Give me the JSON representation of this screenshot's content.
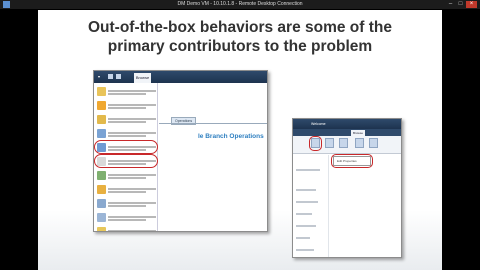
{
  "window": {
    "title": "DM Demo VM - 10.10.1.8 - Remote Desktop Connection",
    "icon": "remote-desktop-icon",
    "controls": [
      "minimize-icon",
      "maximize-icon",
      "close-icon"
    ]
  },
  "slide": {
    "headline_line1": "Out-of-the-box behaviors are some of the",
    "headline_line2": "primary contributors to the problem"
  },
  "screenshot_left": {
    "ribbon_tab_active": "Browse",
    "menu_item_count": 11,
    "content_heading": "le Branch Operations",
    "content_tab_selected": "Operations"
  },
  "screenshot_right": {
    "ribbon_tab_active": "Browse",
    "page_title": "Welcome",
    "dropdown_item": "Edit Page",
    "textbox_item": "Edit Properties"
  },
  "colors": {
    "window_background": "#000000",
    "headline": "#333333",
    "callout_ring": "#c8282a",
    "sharepoint_link": "#2e7fc0",
    "ribbon_dark": "#1d334f"
  }
}
